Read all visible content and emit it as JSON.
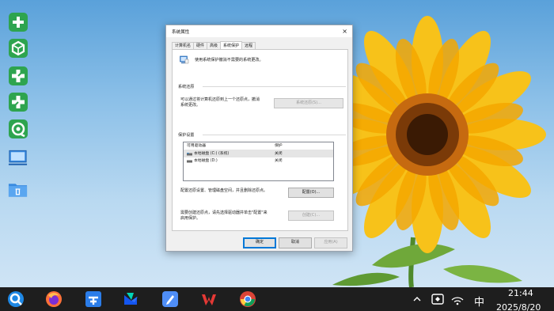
{
  "desktop": {
    "icons": [
      {
        "name": "app-green-plus-icon",
        "color": "#2ea44f"
      },
      {
        "name": "app-green-cube-icon",
        "color": "#2ea44f"
      },
      {
        "name": "app-green-cross-icon",
        "color": "#2ea44f"
      },
      {
        "name": "app-green-cross-2-icon",
        "color": "#2ea44f"
      },
      {
        "name": "app-green-refresh-icon",
        "color": "#2ea44f"
      },
      {
        "name": "computer-icon",
        "color": "#2b88d8"
      },
      {
        "name": "recycle-bin-icon",
        "color": "#2b88d8"
      }
    ]
  },
  "dialog": {
    "title": "系统属性",
    "close_glyph": "×",
    "tabs": [
      "计算机名",
      "硬件",
      "高级",
      "系统保护",
      "远程"
    ],
    "active_tab": 3,
    "intro_text": "使用系统保护撤消不需要的系统更改。",
    "restore_group_label": "系统还原",
    "restore_para_line1": "可以通过将计算机还原到上一个还原点，撤消",
    "restore_para_line2": "系统更改。",
    "restore_button": "系统还原(S)...",
    "protection_group_label": "保护设置",
    "list_header": {
      "col1": "可用驱动器",
      "col2": "保护"
    },
    "drives": [
      {
        "name": "本地磁盘 (C:) (系统)",
        "status": "关闭",
        "selected": true
      },
      {
        "name": "本地磁盘 (D:)",
        "status": "关闭",
        "selected": false
      }
    ],
    "configure_text": "配置还原设置、管理磁盘空间，并且删除还原点。",
    "configure_button": "配置(O)...",
    "create_text_line1": "需要创建还原点，请先选择驱动器并单击\"配置\"来",
    "create_text_line2": "启用保护。",
    "create_button": "创建(C)...",
    "ok_button": "确定",
    "cancel_button": "取消",
    "apply_button": "应用(A)"
  },
  "taskbar": {
    "apps": [
      {
        "name": "search-app-icon",
        "color": "#1e88e5"
      },
      {
        "name": "firefox-icon",
        "color": "#ff7139"
      },
      {
        "name": "pinned-app-blue-icon",
        "color": "#2b7de9"
      },
      {
        "name": "feishu-icon",
        "color": "#1456f0"
      },
      {
        "name": "notes-pen-icon",
        "color": "#4f8ef7"
      },
      {
        "name": "wps-icon",
        "color": "#e53935"
      },
      {
        "name": "chrome-icon",
        "color": "#4285f4"
      }
    ],
    "ime": "中",
    "time": "21:44",
    "date": "2025/8/20"
  }
}
